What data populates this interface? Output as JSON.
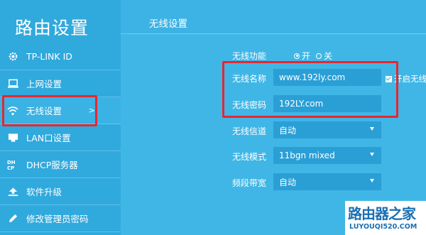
{
  "sidebar": {
    "title": "路由设置",
    "items": [
      {
        "label": "TP-LINK ID",
        "icon": "gear-icon"
      },
      {
        "label": "上网设置",
        "icon": "monitor-icon"
      },
      {
        "label": "无线设置",
        "icon": "wifi-icon",
        "active": true,
        "arrow": ">"
      },
      {
        "label": "LAN口设置",
        "icon": "lan-port-icon"
      },
      {
        "label": "DHCP服务器",
        "icon": "dhcp-icon"
      },
      {
        "label": "软件升级",
        "icon": "upload-icon"
      },
      {
        "label": "修改管理员密码",
        "icon": "pencil-icon"
      }
    ]
  },
  "main": {
    "title": "无线设置",
    "wireless_function": {
      "label": "无线功能",
      "on": "开",
      "off": "关",
      "selected": "on"
    },
    "ssid": {
      "label": "无线名称",
      "value": "www.192ly.com"
    },
    "hide_ssid": {
      "label": "开启无线",
      "checked": true
    },
    "password": {
      "label": "无线密码",
      "value": "192LY.com"
    },
    "channel": {
      "label": "无线信道",
      "value": "自动"
    },
    "mode": {
      "label": "无线模式",
      "value": "11bgn mixed"
    },
    "bandwidth": {
      "label": "频段带宽",
      "value": "自动"
    }
  },
  "watermark": {
    "title": "路由器之家",
    "url": "LUYOUQI520.COM"
  },
  "colors": {
    "sidebar_bg": "#30a9dd",
    "main_bg": "#40b6e6",
    "field_bg": "#2a9fd6",
    "highlight": "#e8262e",
    "save_button": "#f6d300"
  }
}
